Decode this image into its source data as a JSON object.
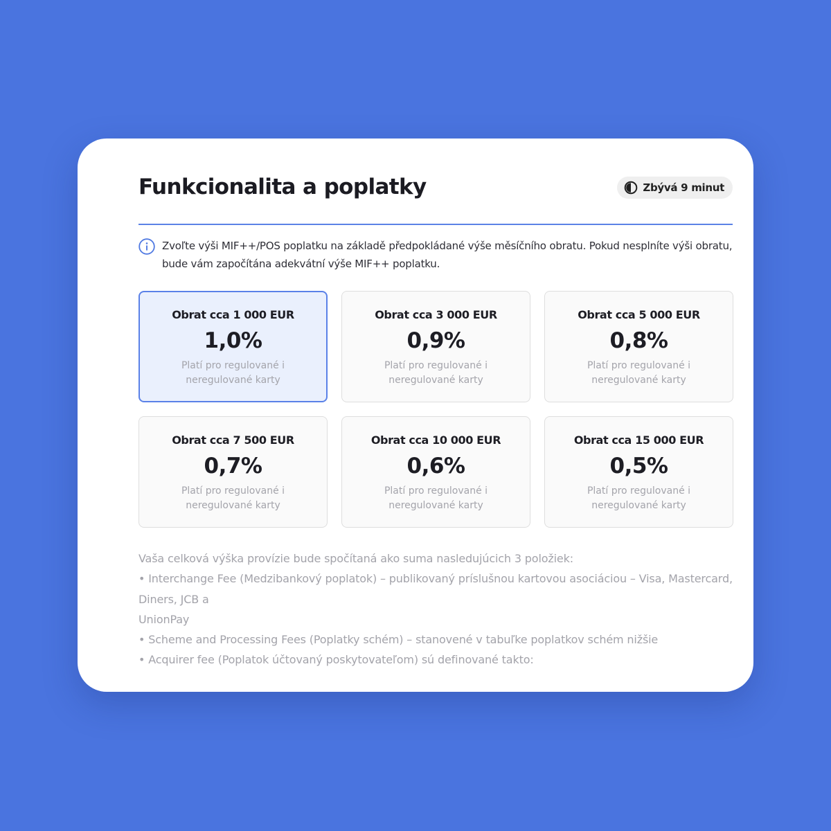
{
  "page": {
    "title": "Funkcionalita a poplatky",
    "timer_label": "Zbývá 9 minut",
    "timer_icon": "half-circle-clock-icon",
    "info_icon": "info-icon",
    "info_text": "Zvoľte výši MIF++/POS poplatku na základě předpokládané výše měsíčního obratu. Pokud nesplníte výši obratu, bude vám započítána adekvátní výše MIF++ poplatku."
  },
  "tiers": [
    {
      "label": "Obrat cca 1 000 EUR",
      "rate": "1,0%",
      "desc": "Platí pro regulované i neregulované karty",
      "selected": true
    },
    {
      "label": "Obrat cca 3 000 EUR",
      "rate": "0,9%",
      "desc": "Platí pro regulované i neregulované karty",
      "selected": false
    },
    {
      "label": "Obrat cca 5 000 EUR",
      "rate": "0,8%",
      "desc": "Platí pro regulované i neregulované karty",
      "selected": false
    },
    {
      "label": "Obrat cca 7 500 EUR",
      "rate": "0,7%",
      "desc": "Platí pro regulované i neregulované karty",
      "selected": false
    },
    {
      "label": "Obrat cca 10 000 EUR",
      "rate": "0,6%",
      "desc": "Platí pro regulované i neregulované karty",
      "selected": false
    },
    {
      "label": "Obrat cca 15 000 EUR",
      "rate": "0,5%",
      "desc": "Platí pro regulované i neregulované karty",
      "selected": false
    }
  ],
  "notes": [
    "Vaša celková výška provízie bude spočítaná ako suma nasledujúcich 3 položiek:",
    "• Interchange Fee (Medzibankový poplatok) – publikovaný príslušnou kartovou asociáciou – Visa, Mastercard, Diners, JCB a",
    "UnionPay",
    "• Scheme and Processing Fees (Poplatky schém) – stanovené v tabuľke poplatkov schém nižšie",
    "• Acquirer fee (Poplatok účtovaný poskytovateľom) sú definované takto:"
  ],
  "colors": {
    "background": "#4a74df",
    "accent": "#5a81e8",
    "selected_fill": "#eaf0fd"
  }
}
